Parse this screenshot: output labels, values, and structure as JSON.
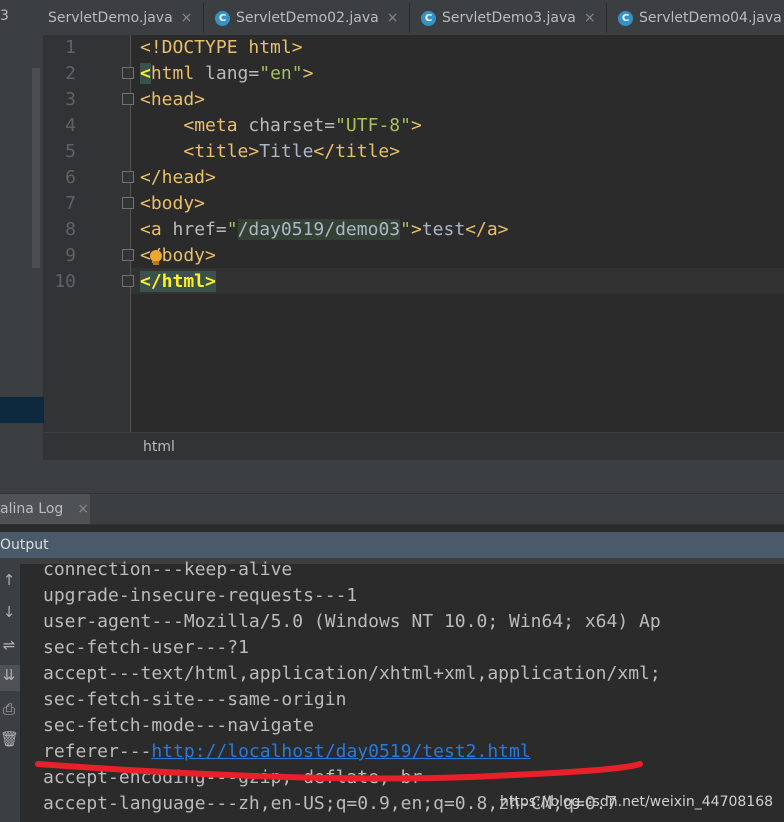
{
  "tabs": {
    "corner": "3",
    "items": [
      {
        "label": "ServletDemo.java",
        "icon": "class-icon",
        "close": "×"
      },
      {
        "label": "ServletDemo02.java",
        "icon": "class-icon",
        "close": "×"
      },
      {
        "label": "ServletDemo3.java",
        "icon": "class-icon",
        "close": "×"
      },
      {
        "label": "ServletDemo04.java",
        "icon": "class-icon",
        "close": ""
      }
    ],
    "class_glyph": "C"
  },
  "editor": {
    "line_numbers": [
      "1",
      "2",
      "3",
      "4",
      "5",
      "6",
      "7",
      "8",
      "9",
      "10"
    ],
    "lines": [
      {
        "parts": [
          {
            "t": "tag",
            "v": "<!DOCTYPE html>"
          }
        ]
      },
      {
        "parts": [
          {
            "t": "brk",
            "v": "<"
          },
          {
            "t": "tag",
            "v": "html"
          },
          {
            "t": "attr",
            "v": " lang="
          },
          {
            "t": "str",
            "v": "\"en\""
          },
          {
            "t": "tag",
            "v": ">"
          }
        ]
      },
      {
        "parts": [
          {
            "t": "tag",
            "v": "<head>"
          }
        ]
      },
      {
        "parts": [
          {
            "t": "txt",
            "v": "    "
          },
          {
            "t": "tag",
            "v": "<meta"
          },
          {
            "t": "attr",
            "v": " charset="
          },
          {
            "t": "str",
            "v": "\"UTF-8\""
          },
          {
            "t": "tag",
            "v": ">"
          }
        ]
      },
      {
        "parts": [
          {
            "t": "txt",
            "v": "    "
          },
          {
            "t": "tag",
            "v": "<title>"
          },
          {
            "t": "txt",
            "v": "Title"
          },
          {
            "t": "tag",
            "v": "</title>"
          }
        ]
      },
      {
        "parts": [
          {
            "t": "tag",
            "v": "</head>"
          }
        ]
      },
      {
        "parts": [
          {
            "t": "tag",
            "v": "<body>"
          }
        ]
      },
      {
        "parts": [
          {
            "t": "tag",
            "v": "<a"
          },
          {
            "t": "attr",
            "v": " href="
          },
          {
            "t": "str",
            "v": "\""
          },
          {
            "t": "hlstr",
            "v": "/day0519/demo03"
          },
          {
            "t": "str",
            "v": "\""
          },
          {
            "t": "tag",
            "v": ">"
          },
          {
            "t": "txt",
            "v": "test"
          },
          {
            "t": "tag",
            "v": "</a>"
          }
        ]
      },
      {
        "parts": [
          {
            "t": "tag",
            "v": "</body>"
          }
        ]
      },
      {
        "parts": [
          {
            "t": "brk",
            "v": "</html>"
          }
        ]
      }
    ],
    "breadcrumb": "html",
    "accent_fold": "#6f7375",
    "bulb_color": "#f0a732"
  },
  "log": {
    "tab_label": "alina Log",
    "tab_close": "×",
    "output_label": "Output",
    "tools": [
      "↑",
      "↓",
      "⇌",
      "⇊",
      "⎙",
      "🗑"
    ],
    "lines": [
      {
        "pre": "connection---keep-alive"
      },
      {
        "pre": "upgrade-insecure-requests---1"
      },
      {
        "pre": "user-agent---Mozilla/5.0 (Windows NT 10.0; Win64; x64) Ap"
      },
      {
        "pre": "sec-fetch-user---?1"
      },
      {
        "pre": "accept---text/html,application/xhtml+xml,application/xml;"
      },
      {
        "pre": "sec-fetch-site---same-origin"
      },
      {
        "pre": "sec-fetch-mode---navigate"
      },
      {
        "pre": "referer---",
        "link": "http://localhost/day0519/test2.html"
      },
      {
        "pre": "accept-encoding---gzip, deflate, br"
      },
      {
        "pre": "accept-language---zh,en-US;q=0.9,en;q=0.8,zh-CN;q=0.7"
      }
    ],
    "annotation_color": "#e8202a",
    "link_color": "#287bde"
  },
  "watermark": "https://blog.csdn.net/weixin_44708168"
}
